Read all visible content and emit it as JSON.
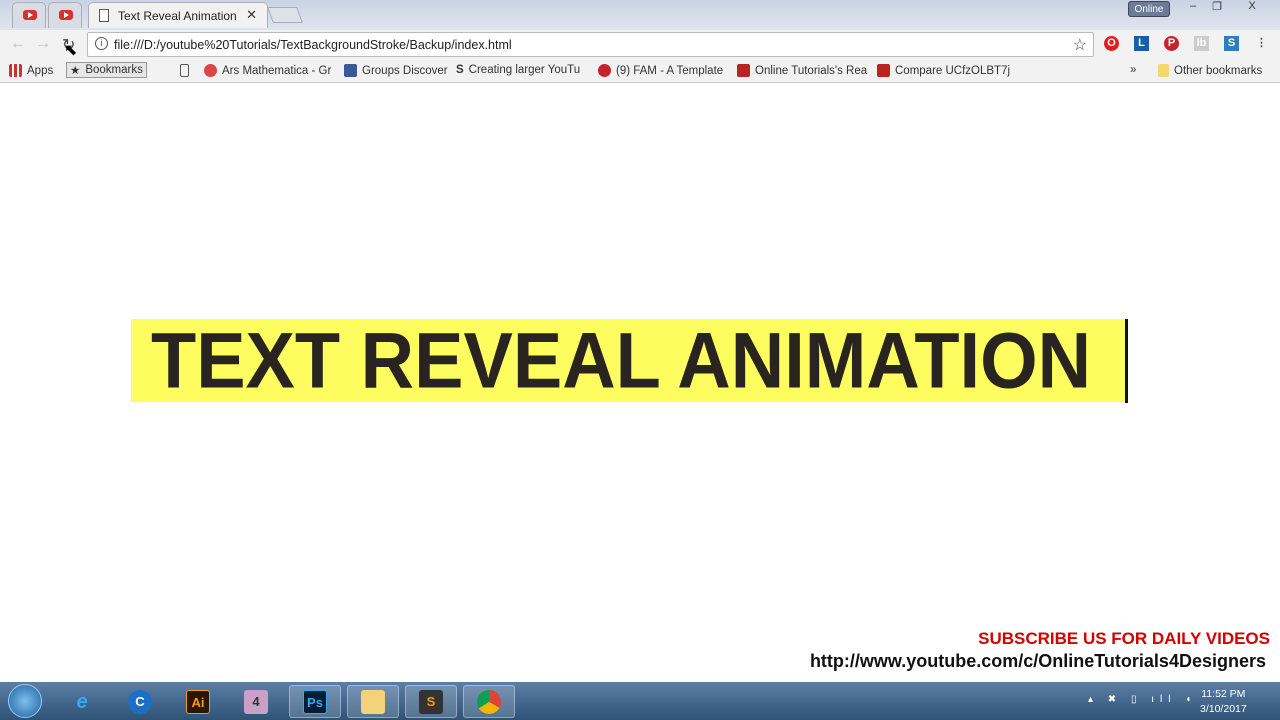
{
  "browser": {
    "tabs": [
      {
        "type": "youtube"
      },
      {
        "type": "youtube"
      },
      {
        "title": "Text Reveal Animation",
        "active": true
      }
    ],
    "online_label": "Online",
    "window_buttons": [
      "–",
      "❐",
      "X"
    ],
    "url": "file:///D:/youtube%20Tutorials/TextBackgroundStroke/Backup/index.html",
    "extensions": [
      "opera-icon",
      "linkedin-icon",
      "pinterest-icon",
      "lb-icon",
      "s-icon",
      "menu-icon"
    ],
    "bookmarks": [
      {
        "label": "Apps",
        "icon": "apps-grid-icon"
      },
      {
        "label": "Bookmarks",
        "icon": "star-icon"
      },
      {
        "label": "",
        "icon": "page-icon"
      },
      {
        "label": "Ars Mathematica - Gr",
        "icon": "google-plus-icon"
      },
      {
        "label": "Groups Discover",
        "icon": "facebook-icon"
      },
      {
        "label": "Creating larger YouTu",
        "icon": "se-icon"
      },
      {
        "label": "(9) FAM - A Template",
        "icon": "pinterest-icon"
      },
      {
        "label": "Online Tutorials's Rea",
        "icon": "chart-icon"
      },
      {
        "label": "Compare UCfzOLBT7j",
        "icon": "chart-icon"
      }
    ],
    "overflow": "»",
    "other_bookmarks": "Other bookmarks"
  },
  "page": {
    "headline": "TEXT REVEAL ANIMATION",
    "banner_color": "#fdfd5f"
  },
  "overlay": {
    "subscribe": "SUBSCRIBE US FOR DAILY VIDEOS",
    "channel_url": "http://www.youtube.com/c/OnlineTutorials4Designers"
  },
  "taskbar": {
    "apps": [
      {
        "name": "internet-explorer",
        "label": "e"
      },
      {
        "name": "ccleaner",
        "label": "C"
      },
      {
        "name": "illustrator",
        "label": "Ai"
      },
      {
        "name": "app4",
        "label": "4"
      },
      {
        "name": "photoshop",
        "label": "Ps"
      },
      {
        "name": "explorer",
        "label": ""
      },
      {
        "name": "sublime",
        "label": "S"
      },
      {
        "name": "chrome",
        "label": ""
      }
    ],
    "time": "11:52 PM",
    "date": "3/10/2017"
  }
}
